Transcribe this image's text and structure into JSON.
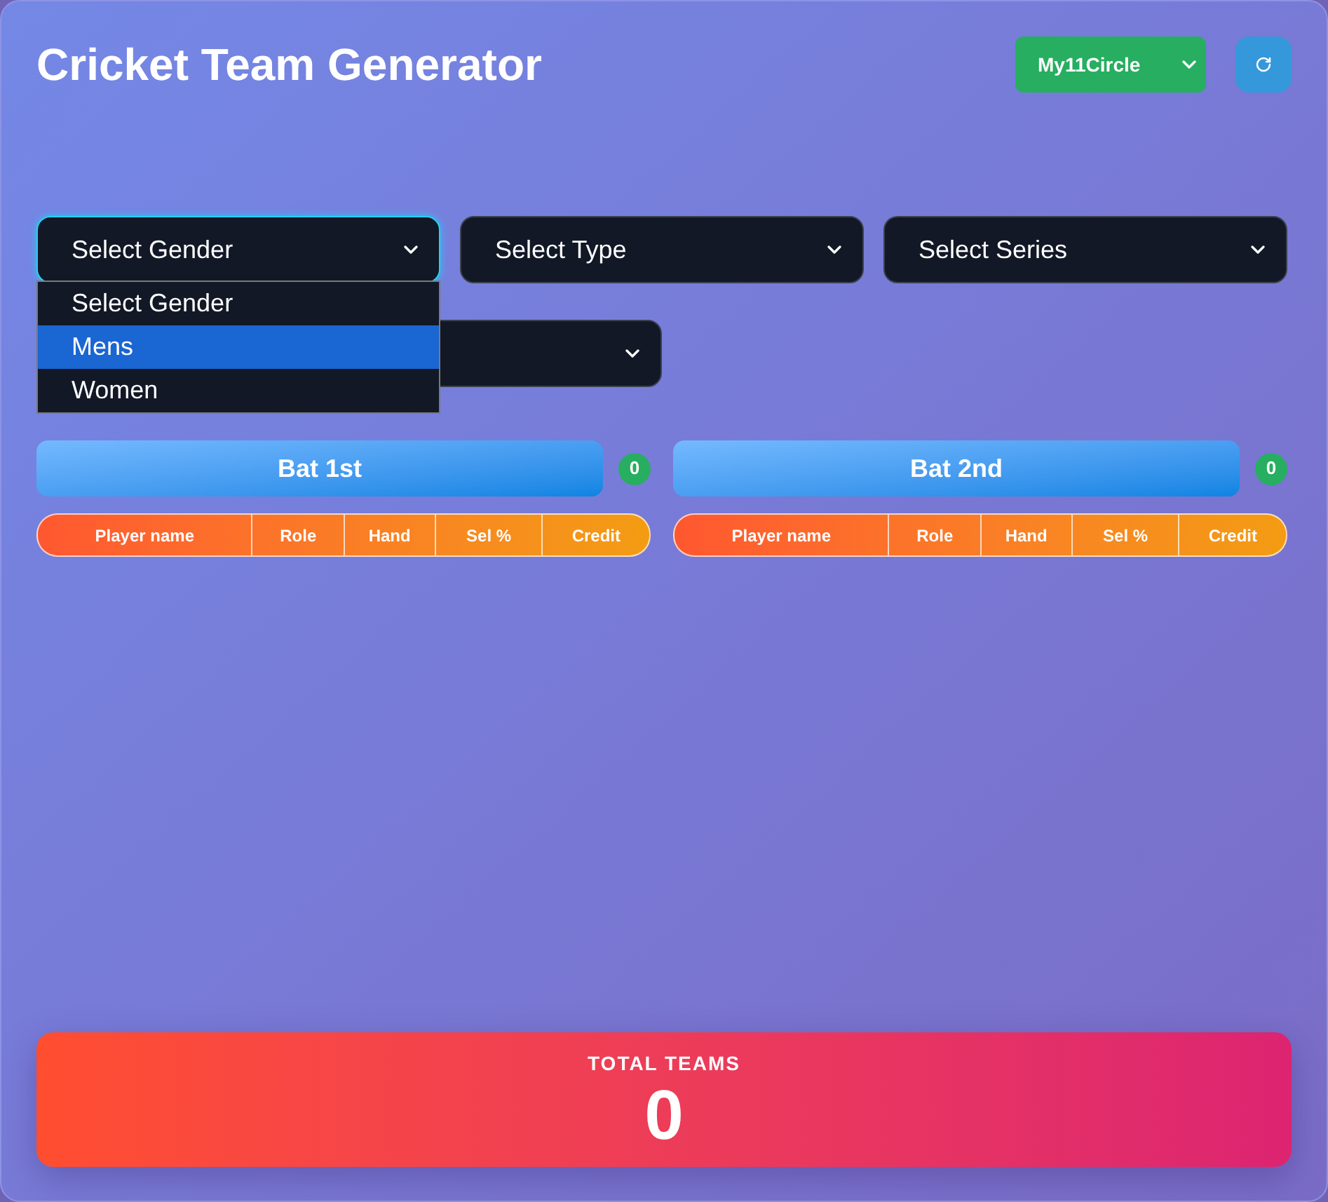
{
  "header": {
    "title": "Cricket Team Generator",
    "platform_select": {
      "value": "My11Circle"
    }
  },
  "filters": [
    {
      "label": "Select Gender",
      "focused": true,
      "expanded": true,
      "options": [
        {
          "label": "Select Gender",
          "selected": false
        },
        {
          "label": "Mens",
          "selected": true
        },
        {
          "label": "Women",
          "selected": false
        }
      ]
    },
    {
      "label": "Select Type",
      "focused": false
    },
    {
      "label": "Select Series",
      "focused": false
    },
    {
      "focused": false
    }
  ],
  "teams": [
    {
      "title": "Bat 1st",
      "count": "0",
      "columns": [
        "Player name",
        "Role",
        "Hand",
        "Sel %",
        "Credit"
      ]
    },
    {
      "title": "Bat 2nd",
      "count": "0",
      "columns": [
        "Player name",
        "Role",
        "Hand",
        "Sel %",
        "Credit"
      ]
    }
  ],
  "total": {
    "label": "TOTAL TEAMS",
    "value": "0"
  }
}
